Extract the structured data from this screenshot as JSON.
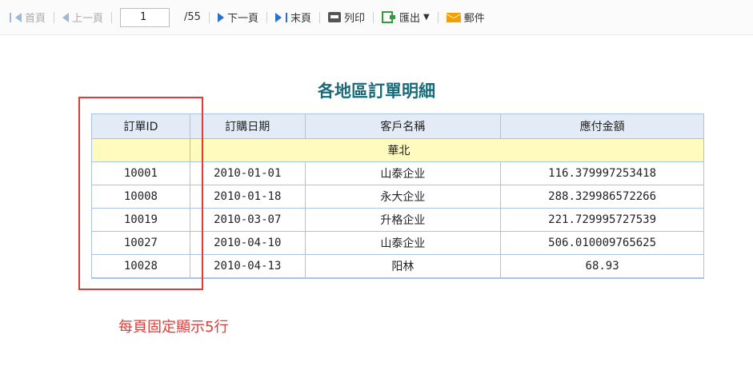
{
  "toolbar": {
    "first": "首頁",
    "prev": "上一頁",
    "page_value": "1",
    "total": "/55",
    "next": "下一頁",
    "last": "末頁",
    "print": "列印",
    "export": "匯出",
    "mail": "郵件"
  },
  "report": {
    "title": "各地區訂單明細",
    "headers": [
      "訂單ID",
      "訂購日期",
      "客戶名稱",
      "應付金額"
    ],
    "group": "華北",
    "rows": [
      {
        "id": "10001",
        "date": "2010-01-01",
        "customer": "山泰企业",
        "amount": "116.379997253418"
      },
      {
        "id": "10008",
        "date": "2010-01-18",
        "customer": "永大企业",
        "amount": "288.329986572266"
      },
      {
        "id": "10019",
        "date": "2010-03-07",
        "customer": "升格企业",
        "amount": "221.729995727539"
      },
      {
        "id": "10027",
        "date": "2010-04-10",
        "customer": "山泰企业",
        "amount": "506.010009765625"
      },
      {
        "id": "10028",
        "date": "2010-04-13",
        "customer": "阳林",
        "amount": "68.93"
      }
    ]
  },
  "annotation": {
    "note": "每頁固定顯示5行",
    "color": "#e53935"
  }
}
